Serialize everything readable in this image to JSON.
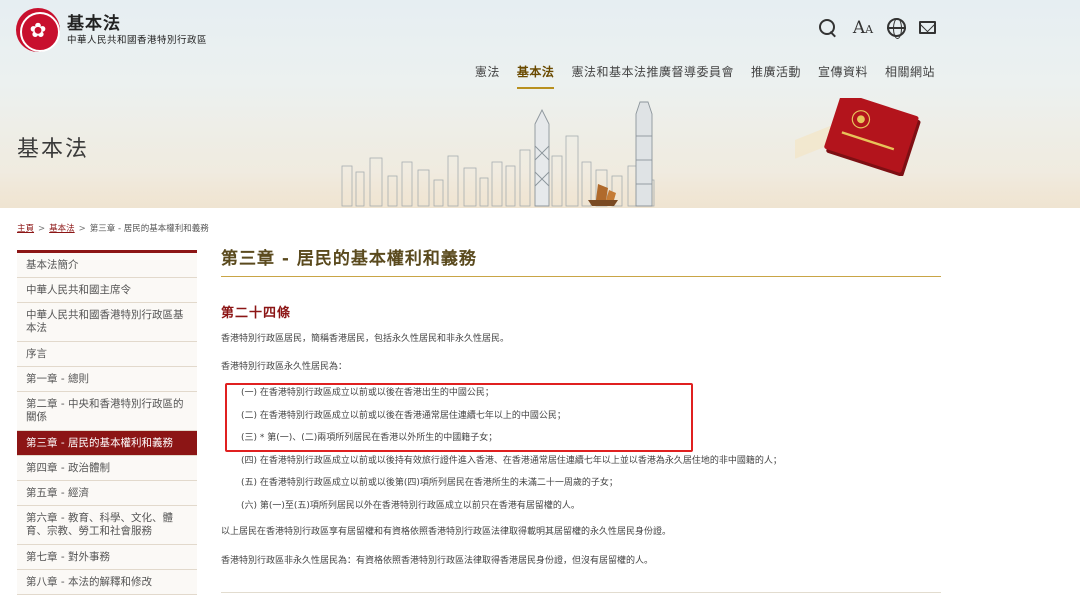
{
  "header": {
    "logo_title": "基本法",
    "logo_subtitle": "中華人民共和國香港特別行政區",
    "icons": [
      "search-icon",
      "font-size-icon",
      "globe-icon",
      "mail-icon"
    ],
    "font_icon_text": "A",
    "nav": [
      {
        "label": "憲法",
        "active": false
      },
      {
        "label": "基本法",
        "active": true
      },
      {
        "label": "憲法和基本法推廣督導委員會",
        "active": false
      },
      {
        "label": "推廣活動",
        "active": false
      },
      {
        "label": "宣傳資料",
        "active": false
      },
      {
        "label": "相關網站",
        "active": false
      }
    ],
    "banner_title": "基本法"
  },
  "breadcrumb": {
    "home": "主頁",
    "sep": ">",
    "basic_law": "基本法",
    "current": "第三章 - 居民的基本權利和義務"
  },
  "sidebar": {
    "items": [
      {
        "label": "基本法簡介"
      },
      {
        "label": "中華人民共和國主席令"
      },
      {
        "label": "中華人民共和國香港特別行政區基本法"
      },
      {
        "label": "序言"
      },
      {
        "label": "第一章 - 總則"
      },
      {
        "label": "第二章 - 中央和香港特別行政區的關係"
      },
      {
        "label": "第三章 - 居民的基本權利和義務",
        "active": true
      },
      {
        "label": "第四章 - 政治體制"
      },
      {
        "label": "第五章 - 經濟"
      },
      {
        "label": "第六章 - 教育、科學、文化、體育、宗教、勞工和社會服務"
      },
      {
        "label": "第七章 - 對外事務"
      },
      {
        "label": "第八章 - 本法的解釋和修改"
      }
    ]
  },
  "main": {
    "chapter_title": "第三章 - 居民的基本權利和義務",
    "article_title": "第二十四條",
    "para1": "香港特別行政區居民，簡稱香港居民，包括永久性居民和非永久性居民。",
    "para2": "香港特別行政區永久性居民為：",
    "list": [
      "(一) 在香港特別行政區成立以前或以後在香港出生的中國公民；",
      "(二) 在香港特別行政區成立以前或以後在香港通常居住連續七年以上的中國公民；",
      "(三) * 第(一)、(二)兩項所列居民在香港以外所生的中國籍子女；",
      "(四) 在香港特別行政區成立以前或以後持有效旅行證件進入香港、在香港通常居住連續七年以上並以香港為永久居住地的非中國籍的人；",
      "(五) 在香港特別行政區成立以前或以後第(四)項所列居民在香港所生的未滿二十一周歲的子女；",
      "(六) 第(一)至(五)項所列居民以外在香港特別行政區成立以前只在香港有居留權的人。"
    ],
    "para3": "以上居民在香港特別行政區享有居留權和有資格依照香港特別行政區法律取得載明其居留權的永久性居民身份證。",
    "para4": "香港特別行政區非永久性居民為：有資格依照香港特別行政區法律取得香港居民身份證，但沒有居留權的人。"
  },
  "colors": {
    "accent_red": "#8c1515",
    "gold": "#c9a546",
    "highlight_border": "#e02020"
  }
}
